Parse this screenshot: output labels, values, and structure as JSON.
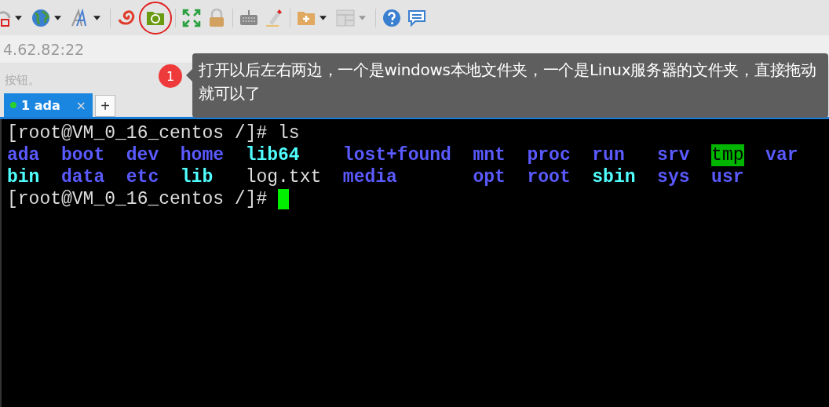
{
  "address": "4.62.82:22",
  "hint": "按钮。",
  "callout": {
    "badge": "1",
    "text": "打开以后左右两边，一个是windows本地文件夹，一个是Linux服务器的文件夹，直接拖动就可以了"
  },
  "tabs": [
    {
      "label": "1 ada",
      "selected": true,
      "connected": true,
      "close": "×"
    }
  ],
  "new_tab": "+",
  "terminal": {
    "lines": [
      {
        "kind": "prompt",
        "text": "[root@VM_0_16_centos /]# ls",
        "cursor": false
      },
      {
        "kind": "listing",
        "items": [
          {
            "name": "ada",
            "kind": "dir"
          },
          {
            "name": "boot",
            "kind": "dir"
          },
          {
            "name": "dev",
            "kind": "dir"
          },
          {
            "name": "home",
            "kind": "dir"
          },
          {
            "name": "lib64",
            "kind": "link"
          },
          {
            "name": "lost+found",
            "kind": "dir"
          },
          {
            "name": "mnt",
            "kind": "dir"
          },
          {
            "name": "proc",
            "kind": "dir"
          },
          {
            "name": "run",
            "kind": "dir"
          },
          {
            "name": "srv",
            "kind": "dir"
          },
          {
            "name": "tmp",
            "kind": "sticky"
          },
          {
            "name": "var",
            "kind": "dir"
          }
        ]
      },
      {
        "kind": "listing",
        "items": [
          {
            "name": "bin",
            "kind": "link"
          },
          {
            "name": "data",
            "kind": "dir"
          },
          {
            "name": "etc",
            "kind": "dir"
          },
          {
            "name": "lib",
            "kind": "link"
          },
          {
            "name": "log.txt",
            "kind": "file"
          },
          {
            "name": "media",
            "kind": "dir"
          },
          {
            "name": "opt",
            "kind": "dir"
          },
          {
            "name": "root",
            "kind": "dir"
          },
          {
            "name": "sbin",
            "kind": "link"
          },
          {
            "name": "sys",
            "kind": "dir"
          },
          {
            "name": "usr",
            "kind": "dir"
          }
        ]
      },
      {
        "kind": "prompt",
        "text": "[root@VM_0_16_centos /]#",
        "cursor": true
      }
    ]
  }
}
